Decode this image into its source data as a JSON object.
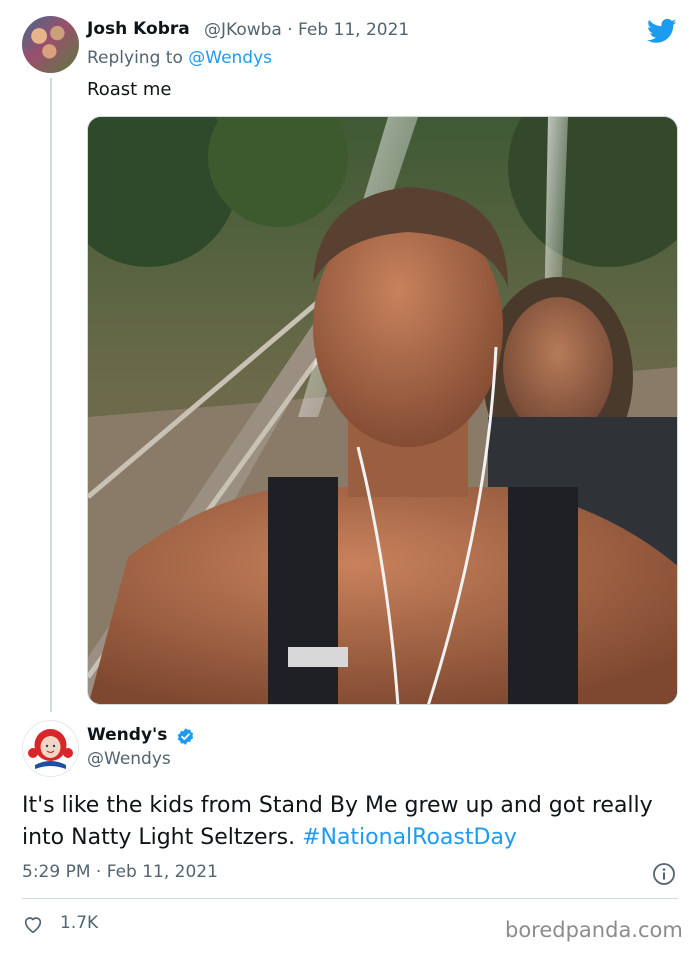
{
  "original_tweet": {
    "author_name": "Josh Kobra",
    "author_handle": "@JKowba",
    "separator": "·",
    "date": "Feb 11, 2021",
    "replying_prefix": "Replying to",
    "replying_to": "@Wendys",
    "text": "Roast me"
  },
  "reply_tweet": {
    "author_name": "Wendy's",
    "author_handle": "@Wendys",
    "text": "It's like the kids from Stand By Me grew up and got really into Natty Light Seltzers.",
    "hashtag": "#NationalRoastDay",
    "time": "5:29 PM",
    "separator": "·",
    "date": "Feb 11, 2021",
    "likes": "1.7K"
  },
  "watermark": "boredpanda.com",
  "icons": [
    "twitter-bird-icon",
    "verified-badge-icon",
    "info-icon",
    "heart-icon"
  ],
  "colors": {
    "accent": "#1d9bf0",
    "secondary_text": "#536471",
    "divider": "#cfd9de"
  }
}
